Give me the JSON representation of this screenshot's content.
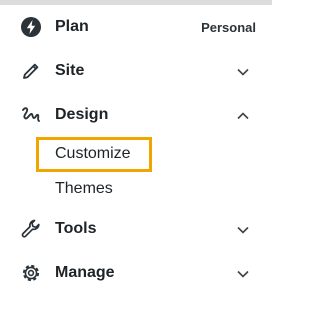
{
  "menu": {
    "plan": {
      "label": "Plan",
      "badge": "Personal",
      "icon": "plan-bolt-icon"
    },
    "site": {
      "label": "Site",
      "icon": "pencil-icon"
    },
    "design": {
      "label": "Design",
      "icon": "design-squiggle-icon",
      "expanded": true,
      "children": [
        {
          "label": "Customize",
          "highlighted": true
        },
        {
          "label": "Themes"
        }
      ]
    },
    "tools": {
      "label": "Tools",
      "icon": "wrench-icon"
    },
    "manage": {
      "label": "Manage",
      "icon": "gear-icon"
    }
  },
  "colors": {
    "highlight": "#f0a500",
    "text": "#1d2327",
    "top_bar": "#dcdcde"
  }
}
